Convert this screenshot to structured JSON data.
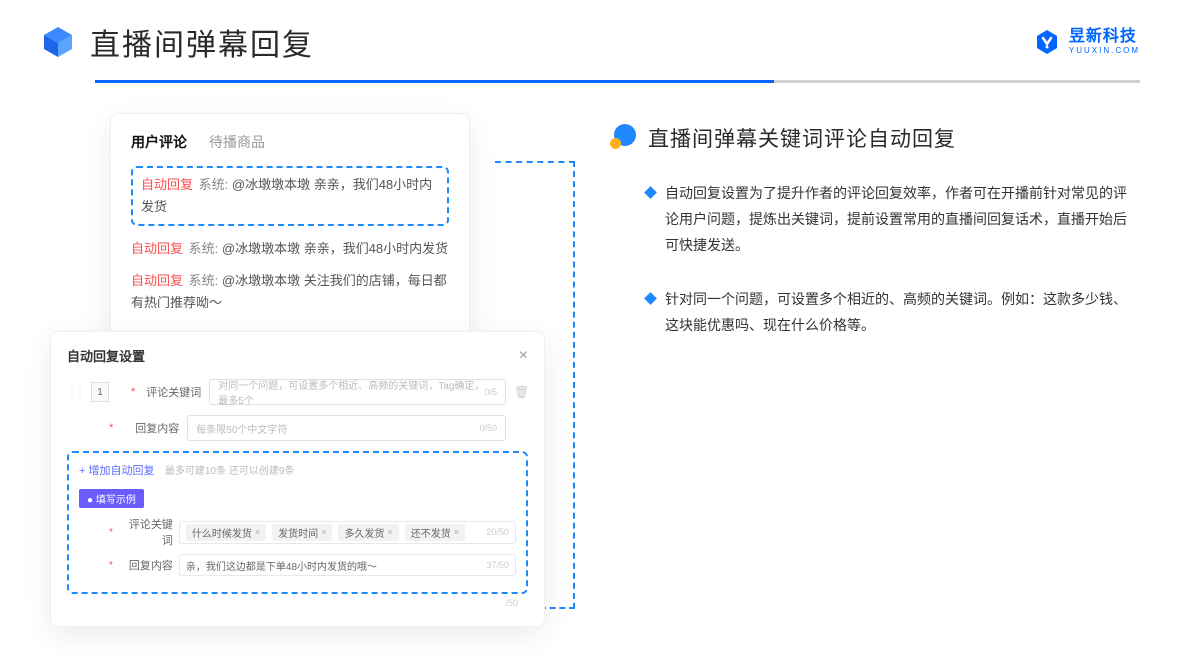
{
  "header": {
    "title": "直播间弹幕回复",
    "logo_cn": "昱新科技",
    "logo_en": "YUUXIN.COM"
  },
  "card1": {
    "tab_active": "用户评论",
    "tab_inactive": "待播商品",
    "highlighted": {
      "tag": "自动回复",
      "sys": "系统:",
      "text": "@冰墩墩本墩 亲亲，我们48小时内发货"
    },
    "row2": {
      "tag": "自动回复",
      "sys": "系统:",
      "text": "@冰墩墩本墩 亲亲，我们48小时内发货"
    },
    "row3": {
      "tag": "自动回复",
      "sys": "系统:",
      "text": "@冰墩墩本墩 关注我们的店铺，每日都有热门推荐呦～"
    }
  },
  "card2": {
    "title": "自动回复设置",
    "close": "×",
    "idx": "1",
    "label_keyword": "评论关键词",
    "placeholder_keyword": "对同一个问题，可设置多个相近、高频的关键词，Tag确定，最多5个",
    "count_keyword": "0/5",
    "label_content": "回复内容",
    "placeholder_content": "每条限50个中文字符",
    "count_content": "0/50",
    "add_link": "+ 增加自动回复",
    "add_hint": "最多可建10条 还可以创建9条",
    "example_badge": "● 填写示例",
    "example_label_kw": "评论关键词",
    "example_tags": [
      "什么时候发货",
      "发货时间",
      "多久发货",
      "还不发货"
    ],
    "example_kw_count": "20/50",
    "example_label_content": "回复内容",
    "example_content_text": "亲，我们这边都是下单48小时内发货的哦～",
    "example_content_count": "37/50",
    "outer_count": "/50"
  },
  "right": {
    "title": "直播间弹幕关键词评论自动回复",
    "bullet1": "自动回复设置为了提升作者的评论回复效率，作者可在开播前针对常见的评论用户问题，提炼出关键词，提前设置常用的直播间回复话术，直播开始后可快捷发送。",
    "bullet2": "针对同一个问题，可设置多个相近的、高频的关键词。例如：这款多少钱、这块能优惠吗、现在什么价格等。"
  }
}
